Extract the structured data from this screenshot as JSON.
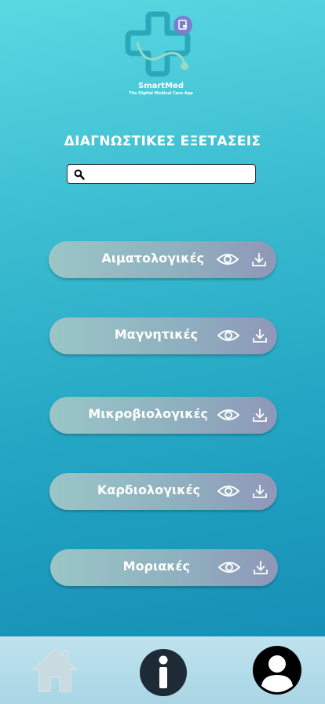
{
  "app": {
    "brand_name": "SmartMed",
    "brand_tagline": "The Digital Medical Care App"
  },
  "page_title": "ΔΙΑΓΝΩΣΤΙΚΕΣ ΕΞΕΤΑΣΕΙΣ",
  "search": {
    "value": "",
    "placeholder": ""
  },
  "exams": [
    {
      "label": "Αιματολογικές",
      "view_icon": "eye-icon",
      "download_icon": "download-icon"
    },
    {
      "label": "Μαγνητικές",
      "view_icon": "eye-icon",
      "download_icon": "download-icon"
    },
    {
      "label": "Μικροβιολογικές",
      "view_icon": "eye-icon",
      "download_icon": "download-icon"
    },
    {
      "label": "Καρδιολογικές",
      "view_icon": "eye-icon",
      "download_icon": "download-icon"
    },
    {
      "label": "Μοριακές",
      "view_icon": "eye-icon",
      "download_icon": "download-icon"
    }
  ],
  "nav": [
    {
      "name": "home",
      "icon": "home-icon"
    },
    {
      "name": "info",
      "icon": "info-icon"
    },
    {
      "name": "profile",
      "icon": "profile-icon"
    }
  ],
  "colors": {
    "background_top": "#5ad9e2",
    "background_bottom": "#1289b3",
    "button_gradient_start": "#9ac6c7",
    "button_gradient_end": "#8f97b8",
    "bottom_bar": "#bfe3ee",
    "logo_teal": "#2aa9bd",
    "logo_purple": "#7b7fd0"
  }
}
